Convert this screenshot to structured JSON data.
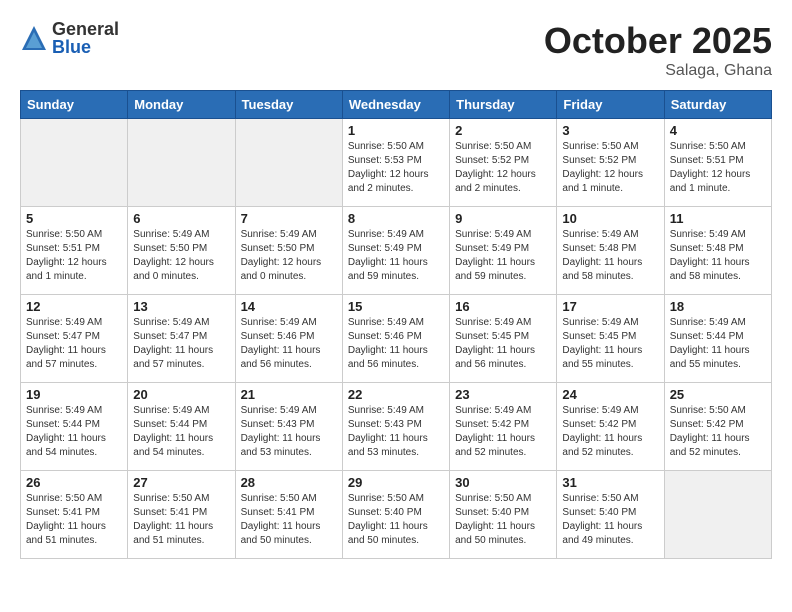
{
  "header": {
    "logo_general": "General",
    "logo_blue": "Blue",
    "month_title": "October 2025",
    "location": "Salaga, Ghana"
  },
  "weekdays": [
    "Sunday",
    "Monday",
    "Tuesday",
    "Wednesday",
    "Thursday",
    "Friday",
    "Saturday"
  ],
  "weeks": [
    [
      {
        "day": "",
        "info": ""
      },
      {
        "day": "",
        "info": ""
      },
      {
        "day": "",
        "info": ""
      },
      {
        "day": "1",
        "info": "Sunrise: 5:50 AM\nSunset: 5:53 PM\nDaylight: 12 hours\nand 2 minutes."
      },
      {
        "day": "2",
        "info": "Sunrise: 5:50 AM\nSunset: 5:52 PM\nDaylight: 12 hours\nand 2 minutes."
      },
      {
        "day": "3",
        "info": "Sunrise: 5:50 AM\nSunset: 5:52 PM\nDaylight: 12 hours\nand 1 minute."
      },
      {
        "day": "4",
        "info": "Sunrise: 5:50 AM\nSunset: 5:51 PM\nDaylight: 12 hours\nand 1 minute."
      }
    ],
    [
      {
        "day": "5",
        "info": "Sunrise: 5:50 AM\nSunset: 5:51 PM\nDaylight: 12 hours\nand 1 minute."
      },
      {
        "day": "6",
        "info": "Sunrise: 5:49 AM\nSunset: 5:50 PM\nDaylight: 12 hours\nand 0 minutes."
      },
      {
        "day": "7",
        "info": "Sunrise: 5:49 AM\nSunset: 5:50 PM\nDaylight: 12 hours\nand 0 minutes."
      },
      {
        "day": "8",
        "info": "Sunrise: 5:49 AM\nSunset: 5:49 PM\nDaylight: 11 hours\nand 59 minutes."
      },
      {
        "day": "9",
        "info": "Sunrise: 5:49 AM\nSunset: 5:49 PM\nDaylight: 11 hours\nand 59 minutes."
      },
      {
        "day": "10",
        "info": "Sunrise: 5:49 AM\nSunset: 5:48 PM\nDaylight: 11 hours\nand 58 minutes."
      },
      {
        "day": "11",
        "info": "Sunrise: 5:49 AM\nSunset: 5:48 PM\nDaylight: 11 hours\nand 58 minutes."
      }
    ],
    [
      {
        "day": "12",
        "info": "Sunrise: 5:49 AM\nSunset: 5:47 PM\nDaylight: 11 hours\nand 57 minutes."
      },
      {
        "day": "13",
        "info": "Sunrise: 5:49 AM\nSunset: 5:47 PM\nDaylight: 11 hours\nand 57 minutes."
      },
      {
        "day": "14",
        "info": "Sunrise: 5:49 AM\nSunset: 5:46 PM\nDaylight: 11 hours\nand 56 minutes."
      },
      {
        "day": "15",
        "info": "Sunrise: 5:49 AM\nSunset: 5:46 PM\nDaylight: 11 hours\nand 56 minutes."
      },
      {
        "day": "16",
        "info": "Sunrise: 5:49 AM\nSunset: 5:45 PM\nDaylight: 11 hours\nand 56 minutes."
      },
      {
        "day": "17",
        "info": "Sunrise: 5:49 AM\nSunset: 5:45 PM\nDaylight: 11 hours\nand 55 minutes."
      },
      {
        "day": "18",
        "info": "Sunrise: 5:49 AM\nSunset: 5:44 PM\nDaylight: 11 hours\nand 55 minutes."
      }
    ],
    [
      {
        "day": "19",
        "info": "Sunrise: 5:49 AM\nSunset: 5:44 PM\nDaylight: 11 hours\nand 54 minutes."
      },
      {
        "day": "20",
        "info": "Sunrise: 5:49 AM\nSunset: 5:44 PM\nDaylight: 11 hours\nand 54 minutes."
      },
      {
        "day": "21",
        "info": "Sunrise: 5:49 AM\nSunset: 5:43 PM\nDaylight: 11 hours\nand 53 minutes."
      },
      {
        "day": "22",
        "info": "Sunrise: 5:49 AM\nSunset: 5:43 PM\nDaylight: 11 hours\nand 53 minutes."
      },
      {
        "day": "23",
        "info": "Sunrise: 5:49 AM\nSunset: 5:42 PM\nDaylight: 11 hours\nand 52 minutes."
      },
      {
        "day": "24",
        "info": "Sunrise: 5:49 AM\nSunset: 5:42 PM\nDaylight: 11 hours\nand 52 minutes."
      },
      {
        "day": "25",
        "info": "Sunrise: 5:50 AM\nSunset: 5:42 PM\nDaylight: 11 hours\nand 52 minutes."
      }
    ],
    [
      {
        "day": "26",
        "info": "Sunrise: 5:50 AM\nSunset: 5:41 PM\nDaylight: 11 hours\nand 51 minutes."
      },
      {
        "day": "27",
        "info": "Sunrise: 5:50 AM\nSunset: 5:41 PM\nDaylight: 11 hours\nand 51 minutes."
      },
      {
        "day": "28",
        "info": "Sunrise: 5:50 AM\nSunset: 5:41 PM\nDaylight: 11 hours\nand 50 minutes."
      },
      {
        "day": "29",
        "info": "Sunrise: 5:50 AM\nSunset: 5:40 PM\nDaylight: 11 hours\nand 50 minutes."
      },
      {
        "day": "30",
        "info": "Sunrise: 5:50 AM\nSunset: 5:40 PM\nDaylight: 11 hours\nand 50 minutes."
      },
      {
        "day": "31",
        "info": "Sunrise: 5:50 AM\nSunset: 5:40 PM\nDaylight: 11 hours\nand 49 minutes."
      },
      {
        "day": "",
        "info": ""
      }
    ]
  ]
}
